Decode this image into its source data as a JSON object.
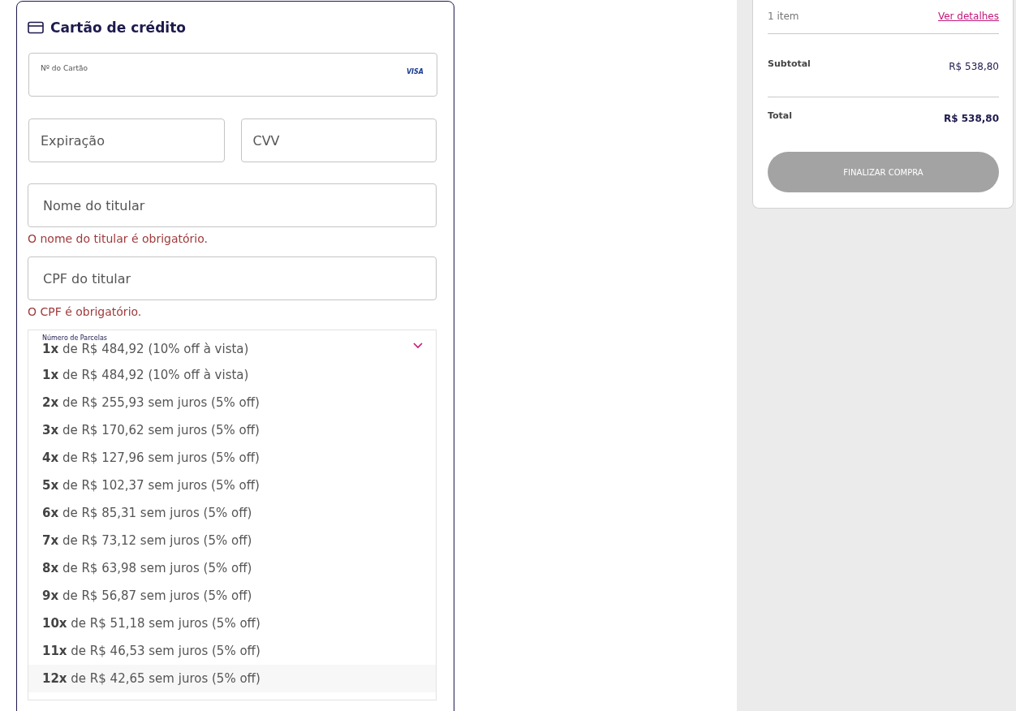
{
  "payment": {
    "title": "Cartão de crédito",
    "card_number": {
      "label": "Nº do Cartão",
      "brand": "VISA"
    },
    "expiration": {
      "placeholder": "Expiração"
    },
    "cvv": {
      "placeholder": "CVV"
    },
    "holder_name": {
      "placeholder": "Nome do titular",
      "error": "O nome do titular é obrigatório."
    },
    "holder_cpf": {
      "placeholder": "CPF do titular",
      "error": "O CPF é obrigatório."
    },
    "installments": {
      "label": "Número de Parcelas",
      "value": "**1x** de R$ 484,92 (10% off à vista)",
      "expanded": true,
      "options": [
        {
          "text": "**1x** de R$ 484,92 (10% off à vista)",
          "highlighted": false
        },
        {
          "text": "**2x** de R$ 255,93 sem juros (5% off)",
          "highlighted": false
        },
        {
          "text": "**3x** de R$ 170,62 sem juros (5% off)",
          "highlighted": false
        },
        {
          "text": "**4x** de R$ 127,96 sem juros (5% off)",
          "highlighted": false
        },
        {
          "text": "**5x** de R$ 102,37 sem juros (5% off)",
          "highlighted": false
        },
        {
          "text": "**6x** de R$ 85,31 sem juros (5% off)",
          "highlighted": false
        },
        {
          "text": "**7x** de R$ 73,12 sem juros (5% off)",
          "highlighted": false
        },
        {
          "text": "**8x** de R$ 63,98 sem juros (5% off)",
          "highlighted": false
        },
        {
          "text": "**9x** de R$ 56,87 sem juros (5% off)",
          "highlighted": false
        },
        {
          "text": "**10x** de R$ 51,18 sem juros (5% off)",
          "highlighted": false
        },
        {
          "text": "**11x** de R$ 46,53 sem juros (5% off)",
          "highlighted": false
        },
        {
          "text": "**12x** de R$ 42,65 sem juros (5% off)",
          "highlighted": true
        }
      ]
    }
  },
  "summary": {
    "items": "1 item",
    "details_link": "Ver detalhes",
    "subtotal": {
      "label": "Subtotal",
      "value": "R$ 538,80"
    },
    "total": {
      "label": "Total",
      "value": "R$ 538,80"
    },
    "checkout_button": {
      "label": "FINALIZAR COMPRA",
      "disabled": true
    }
  }
}
